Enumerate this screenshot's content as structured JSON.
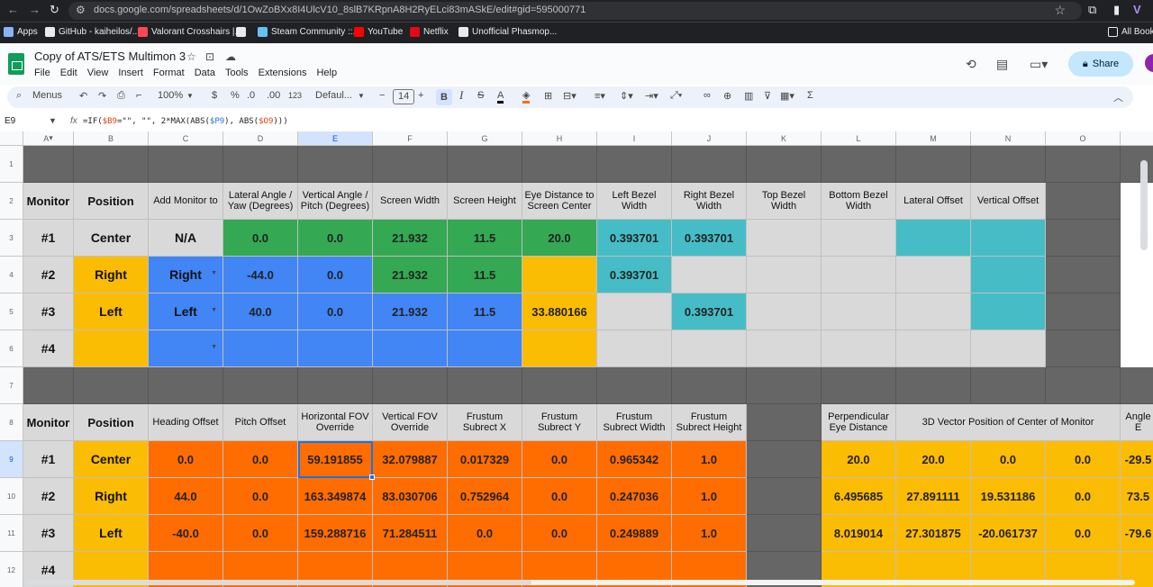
{
  "browser": {
    "url": "docs.google.com/spreadsheets/d/1OwZoBXx8I4UlcV10_8slB7KRpnA8H2RyELci83mASkE/edit#gid=595000771",
    "bookmarks": [
      {
        "label": "Apps",
        "icon": "apps-icon",
        "color": "#8ab4f8"
      },
      {
        "label": "GitHub - kaiheilos/...",
        "icon": "github-icon",
        "color": "#e8eaed"
      },
      {
        "label": "Valorant Crosshairs |...",
        "icon": "valorant-icon",
        "color": "#ff4655"
      },
      {
        "label": "",
        "icon": "globe-icon",
        "color": "#e8eaed"
      },
      {
        "label": "Steam Community ::...",
        "icon": "steam-icon",
        "color": "#66c0f4"
      },
      {
        "label": "YouTube",
        "icon": "youtube-icon",
        "color": "#ff0000"
      },
      {
        "label": "Netflix",
        "icon": "netflix-icon",
        "color": "#e50914"
      },
      {
        "label": "Unofficial Phasmop...",
        "icon": "phasmo-icon",
        "color": "#e8eaed"
      }
    ],
    "all_bookmarks": "All Bookm"
  },
  "doc": {
    "title": "Copy of ATS/ETS Multimon 3",
    "menu": [
      "File",
      "Edit",
      "View",
      "Insert",
      "Format",
      "Data",
      "Tools",
      "Extensions",
      "Help"
    ],
    "share_label": "Share"
  },
  "toolbar": {
    "menus": "Menus",
    "zoom": "100%",
    "currency": "$",
    "percent": "%",
    "dec_less": ".0",
    "dec_more": ".00",
    "format_123": "123",
    "font": "Defaul...",
    "font_size": "14"
  },
  "formula_bar": {
    "cell_ref": "E9",
    "formula_pre": "=IF(",
    "ref1": "$B9",
    "formula_mid1": "=\"\", \"\", 2*MAX(ABS(",
    "ref2": "$P9",
    "formula_mid2": "), ABS(",
    "ref3": "$O9",
    "formula_end": ")))"
  },
  "colors": {
    "dark_gray": "#666666",
    "light_gray": "#d9d9d9",
    "green": "#34a853",
    "blue": "#4285f4",
    "yellow": "#fbbc04",
    "cyan": "#46bdc6",
    "orange": "#ff6d01",
    "white": "#ffffff"
  },
  "sheet": {
    "columns": [
      "A",
      "B",
      "C",
      "D",
      "E",
      "F",
      "G",
      "H",
      "I",
      "J",
      "K",
      "L",
      "M",
      "N",
      "O",
      ""
    ],
    "rows": [
      "1",
      "2",
      "3",
      "4",
      "5",
      "6",
      "7",
      "8",
      "9",
      "10",
      "11",
      "12"
    ],
    "cells": {
      "A2": {
        "t": "Monitor",
        "c": "light_gray",
        "k": "lbl"
      },
      "B2": {
        "t": "Position",
        "c": "light_gray",
        "k": "lbl"
      },
      "C2": {
        "t": "Add Monitor to",
        "c": "light_gray",
        "k": "hdr"
      },
      "D2": {
        "t": "Lateral Angle / Yaw (Degrees)",
        "c": "light_gray",
        "k": "hdr"
      },
      "E2": {
        "t": "Vertical Angle / Pitch (Degrees)",
        "c": "light_gray",
        "k": "hdr"
      },
      "F2": {
        "t": "Screen Width",
        "c": "light_gray",
        "k": "hdr"
      },
      "G2": {
        "t": "Screen Height",
        "c": "light_gray",
        "k": "hdr"
      },
      "H2": {
        "t": "Eye Distance to Screen Center",
        "c": "light_gray",
        "k": "hdr"
      },
      "I2": {
        "t": "Left Bezel Width",
        "c": "light_gray",
        "k": "hdr"
      },
      "J2": {
        "t": "Right Bezel Width",
        "c": "light_gray",
        "k": "hdr"
      },
      "K2": {
        "t": "Top Bezel Width",
        "c": "light_gray",
        "k": "hdr"
      },
      "L2": {
        "t": "Bottom Bezel Width",
        "c": "light_gray",
        "k": "hdr"
      },
      "M2": {
        "t": "Lateral Offset",
        "c": "light_gray",
        "k": "hdr"
      },
      "N2": {
        "t": "Vertical Offset",
        "c": "light_gray",
        "k": "hdr"
      },
      "A3": {
        "t": "#1",
        "c": "light_gray",
        "k": "lbl big"
      },
      "B3": {
        "t": "Center",
        "c": "light_gray",
        "k": "lbl big"
      },
      "C3": {
        "t": "N/A",
        "c": "light_gray",
        "k": "lbl big"
      },
      "D3": {
        "t": "0.0",
        "c": "green",
        "k": "val"
      },
      "E3": {
        "t": "0.0",
        "c": "green",
        "k": "val"
      },
      "F3": {
        "t": "21.932",
        "c": "green",
        "k": "val"
      },
      "G3": {
        "t": "11.5",
        "c": "green",
        "k": "val"
      },
      "H3": {
        "t": "20.0",
        "c": "green",
        "k": "val"
      },
      "I3": {
        "t": "0.393701",
        "c": "cyan",
        "k": "val"
      },
      "J3": {
        "t": "0.393701",
        "c": "cyan",
        "k": "val"
      },
      "K3": {
        "t": "",
        "c": "light_gray",
        "k": "val"
      },
      "L3": {
        "t": "",
        "c": "light_gray",
        "k": "val"
      },
      "M3": {
        "t": "",
        "c": "cyan",
        "k": "val"
      },
      "N3": {
        "t": "",
        "c": "cyan",
        "k": "val"
      },
      "A4": {
        "t": "#2",
        "c": "light_gray",
        "k": "lbl big"
      },
      "B4": {
        "t": "Right",
        "c": "yellow",
        "k": "lbl big"
      },
      "C4": {
        "t": "Right",
        "c": "blue",
        "k": "lbl big",
        "dd": true
      },
      "D4": {
        "t": "-44.0",
        "c": "blue",
        "k": "val"
      },
      "E4": {
        "t": "0.0",
        "c": "blue",
        "k": "val"
      },
      "F4": {
        "t": "21.932",
        "c": "green",
        "k": "val"
      },
      "G4": {
        "t": "11.5",
        "c": "green",
        "k": "val"
      },
      "H4": {
        "t": "",
        "c": "yellow",
        "k": "val"
      },
      "I4": {
        "t": "0.393701",
        "c": "cyan",
        "k": "val"
      },
      "J4": {
        "t": "",
        "c": "light_gray",
        "k": "val"
      },
      "K4": {
        "t": "",
        "c": "light_gray",
        "k": "val"
      },
      "L4": {
        "t": "",
        "c": "light_gray",
        "k": "val"
      },
      "M4": {
        "t": "",
        "c": "light_gray",
        "k": "val"
      },
      "N4": {
        "t": "",
        "c": "cyan",
        "k": "val"
      },
      "A5": {
        "t": "#3",
        "c": "light_gray",
        "k": "lbl big"
      },
      "B5": {
        "t": "Left",
        "c": "yellow",
        "k": "lbl big"
      },
      "C5": {
        "t": "Left",
        "c": "blue",
        "k": "lbl big",
        "dd": true
      },
      "D5": {
        "t": "40.0",
        "c": "blue",
        "k": "val"
      },
      "E5": {
        "t": "0.0",
        "c": "blue",
        "k": "val"
      },
      "F5": {
        "t": "21.932",
        "c": "blue",
        "k": "val"
      },
      "G5": {
        "t": "11.5",
        "c": "blue",
        "k": "val"
      },
      "H5": {
        "t": "33.880166",
        "c": "yellow",
        "k": "val"
      },
      "I5": {
        "t": "",
        "c": "light_gray",
        "k": "val"
      },
      "J5": {
        "t": "0.393701",
        "c": "cyan",
        "k": "val"
      },
      "K5": {
        "t": "",
        "c": "light_gray",
        "k": "val"
      },
      "L5": {
        "t": "",
        "c": "light_gray",
        "k": "val"
      },
      "M5": {
        "t": "",
        "c": "light_gray",
        "k": "val"
      },
      "N5": {
        "t": "",
        "c": "cyan",
        "k": "val"
      },
      "A6": {
        "t": "#4",
        "c": "light_gray",
        "k": "lbl big"
      },
      "B6": {
        "t": "",
        "c": "yellow",
        "k": "lbl"
      },
      "C6": {
        "t": "",
        "c": "blue",
        "k": "lbl",
        "dd": true
      },
      "D6": {
        "t": "",
        "c": "blue",
        "k": "val"
      },
      "E6": {
        "t": "",
        "c": "blue",
        "k": "val"
      },
      "F6": {
        "t": "",
        "c": "blue",
        "k": "val"
      },
      "G6": {
        "t": "",
        "c": "blue",
        "k": "val"
      },
      "H6": {
        "t": "",
        "c": "yellow",
        "k": "val"
      },
      "I6": {
        "t": "",
        "c": "light_gray",
        "k": "val"
      },
      "J6": {
        "t": "",
        "c": "light_gray",
        "k": "val"
      },
      "K6": {
        "t": "",
        "c": "light_gray",
        "k": "val"
      },
      "L6": {
        "t": "",
        "c": "light_gray",
        "k": "val"
      },
      "M6": {
        "t": "",
        "c": "light_gray",
        "k": "val"
      },
      "N6": {
        "t": "",
        "c": "light_gray",
        "k": "val"
      },
      "A8": {
        "t": "Monitor",
        "c": "light_gray",
        "k": "lbl"
      },
      "B8": {
        "t": "Position",
        "c": "light_gray",
        "k": "lbl"
      },
      "C8": {
        "t": "Heading Offset",
        "c": "light_gray",
        "k": "hdr"
      },
      "D8": {
        "t": "Pitch Offset",
        "c": "light_gray",
        "k": "hdr"
      },
      "E8": {
        "t": "Horizontal FOV Override",
        "c": "light_gray",
        "k": "hdr"
      },
      "F8": {
        "t": "Vertical FOV Override",
        "c": "light_gray",
        "k": "hdr"
      },
      "G8": {
        "t": "Frustum Subrect X",
        "c": "light_gray",
        "k": "hdr"
      },
      "H8": {
        "t": "Frustum Subrect Y",
        "c": "light_gray",
        "k": "hdr"
      },
      "I8": {
        "t": "Frustum Subrect Width",
        "c": "light_gray",
        "k": "hdr"
      },
      "J8": {
        "t": "Frustum Subrect Height",
        "c": "light_gray",
        "k": "hdr"
      },
      "L8": {
        "t": "Perpendicular Eye Distance",
        "c": "light_gray",
        "k": "hdr"
      },
      "M8": {
        "t": "3D Vector Position of Center of Monitor",
        "c": "light_gray",
        "k": "hdr",
        "span": 3
      },
      "P8": {
        "t": "Angle E",
        "c": "light_gray",
        "k": "hdr"
      },
      "A9": {
        "t": "#1",
        "c": "light_gray",
        "k": "lbl big"
      },
      "B9": {
        "t": "Center",
        "c": "yellow",
        "k": "lbl big"
      },
      "C9": {
        "t": "0.0",
        "c": "orange",
        "k": "val"
      },
      "D9": {
        "t": "0.0",
        "c": "orange",
        "k": "val"
      },
      "E9": {
        "t": "59.191855",
        "c": "orange",
        "k": "val",
        "sel": true
      },
      "F9": {
        "t": "32.079887",
        "c": "orange",
        "k": "val"
      },
      "G9": {
        "t": "0.017329",
        "c": "orange",
        "k": "val"
      },
      "H9": {
        "t": "0.0",
        "c": "orange",
        "k": "val"
      },
      "I9": {
        "t": "0.965342",
        "c": "orange",
        "k": "val"
      },
      "J9": {
        "t": "1.0",
        "c": "orange",
        "k": "val"
      },
      "L9": {
        "t": "20.0",
        "c": "yellow",
        "k": "val"
      },
      "M9": {
        "t": "20.0",
        "c": "yellow",
        "k": "val"
      },
      "N9": {
        "t": "0.0",
        "c": "yellow",
        "k": "val"
      },
      "O9": {
        "t": "0.0",
        "c": "yellow",
        "k": "val"
      },
      "P9": {
        "t": "-29.5",
        "c": "yellow",
        "k": "val"
      },
      "A10": {
        "t": "#2",
        "c": "light_gray",
        "k": "lbl big"
      },
      "B10": {
        "t": "Right",
        "c": "yellow",
        "k": "lbl big"
      },
      "C10": {
        "t": "44.0",
        "c": "orange",
        "k": "val"
      },
      "D10": {
        "t": "0.0",
        "c": "orange",
        "k": "val"
      },
      "E10": {
        "t": "163.349874",
        "c": "orange",
        "k": "val"
      },
      "F10": {
        "t": "83.030706",
        "c": "orange",
        "k": "val"
      },
      "G10": {
        "t": "0.752964",
        "c": "orange",
        "k": "val"
      },
      "H10": {
        "t": "0.0",
        "c": "orange",
        "k": "val"
      },
      "I10": {
        "t": "0.247036",
        "c": "orange",
        "k": "val"
      },
      "J10": {
        "t": "1.0",
        "c": "orange",
        "k": "val"
      },
      "L10": {
        "t": "6.495685",
        "c": "yellow",
        "k": "val"
      },
      "M10": {
        "t": "27.891111",
        "c": "yellow",
        "k": "val"
      },
      "N10": {
        "t": "19.531186",
        "c": "yellow",
        "k": "val"
      },
      "O10": {
        "t": "0.0",
        "c": "yellow",
        "k": "val"
      },
      "P10": {
        "t": "73.5",
        "c": "yellow",
        "k": "val"
      },
      "A11": {
        "t": "#3",
        "c": "light_gray",
        "k": "lbl big"
      },
      "B11": {
        "t": "Left",
        "c": "yellow",
        "k": "lbl big"
      },
      "C11": {
        "t": "-40.0",
        "c": "orange",
        "k": "val"
      },
      "D11": {
        "t": "0.0",
        "c": "orange",
        "k": "val"
      },
      "E11": {
        "t": "159.288716",
        "c": "orange",
        "k": "val"
      },
      "F11": {
        "t": "71.284511",
        "c": "orange",
        "k": "val"
      },
      "G11": {
        "t": "0.0",
        "c": "orange",
        "k": "val"
      },
      "H11": {
        "t": "0.0",
        "c": "orange",
        "k": "val"
      },
      "I11": {
        "t": "0.249889",
        "c": "orange",
        "k": "val"
      },
      "J11": {
        "t": "1.0",
        "c": "orange",
        "k": "val"
      },
      "L11": {
        "t": "8.019014",
        "c": "yellow",
        "k": "val"
      },
      "M11": {
        "t": "27.301875",
        "c": "yellow",
        "k": "val"
      },
      "N11": {
        "t": "-20.061737",
        "c": "yellow",
        "k": "val"
      },
      "O11": {
        "t": "0.0",
        "c": "yellow",
        "k": "val"
      },
      "P11": {
        "t": "-79.6",
        "c": "yellow",
        "k": "val"
      },
      "A12": {
        "t": "#4",
        "c": "light_gray",
        "k": "lbl big"
      },
      "B12": {
        "t": "",
        "c": "yellow",
        "k": "lbl"
      },
      "C12": {
        "t": "",
        "c": "orange",
        "k": "val"
      },
      "D12": {
        "t": "",
        "c": "orange",
        "k": "val"
      },
      "E12": {
        "t": "",
        "c": "orange",
        "k": "val"
      },
      "F12": {
        "t": "",
        "c": "orange",
        "k": "val"
      },
      "G12": {
        "t": "",
        "c": "orange",
        "k": "val"
      },
      "H12": {
        "t": "",
        "c": "orange",
        "k": "val"
      },
      "I12": {
        "t": "",
        "c": "orange",
        "k": "val"
      },
      "J12": {
        "t": "",
        "c": "orange",
        "k": "val"
      },
      "L12": {
        "t": "",
        "c": "yellow",
        "k": "val"
      },
      "M12": {
        "t": "",
        "c": "yellow",
        "k": "val"
      },
      "N12": {
        "t": "",
        "c": "yellow",
        "k": "val"
      },
      "O12": {
        "t": "",
        "c": "yellow",
        "k": "val"
      },
      "P12": {
        "t": "",
        "c": "yellow",
        "k": "val"
      }
    },
    "dark_rows": [
      "1",
      "7"
    ],
    "dark_cells": [
      "K8",
      "K9",
      "K10",
      "K11",
      "K12",
      "O2",
      "O3",
      "O4",
      "O5",
      "O6",
      "P2",
      "P3",
      "P4",
      "P5",
      "P6"
    ],
    "white_cells": [
      "P2",
      "P3",
      "P4",
      "P5",
      "P6"
    ]
  }
}
